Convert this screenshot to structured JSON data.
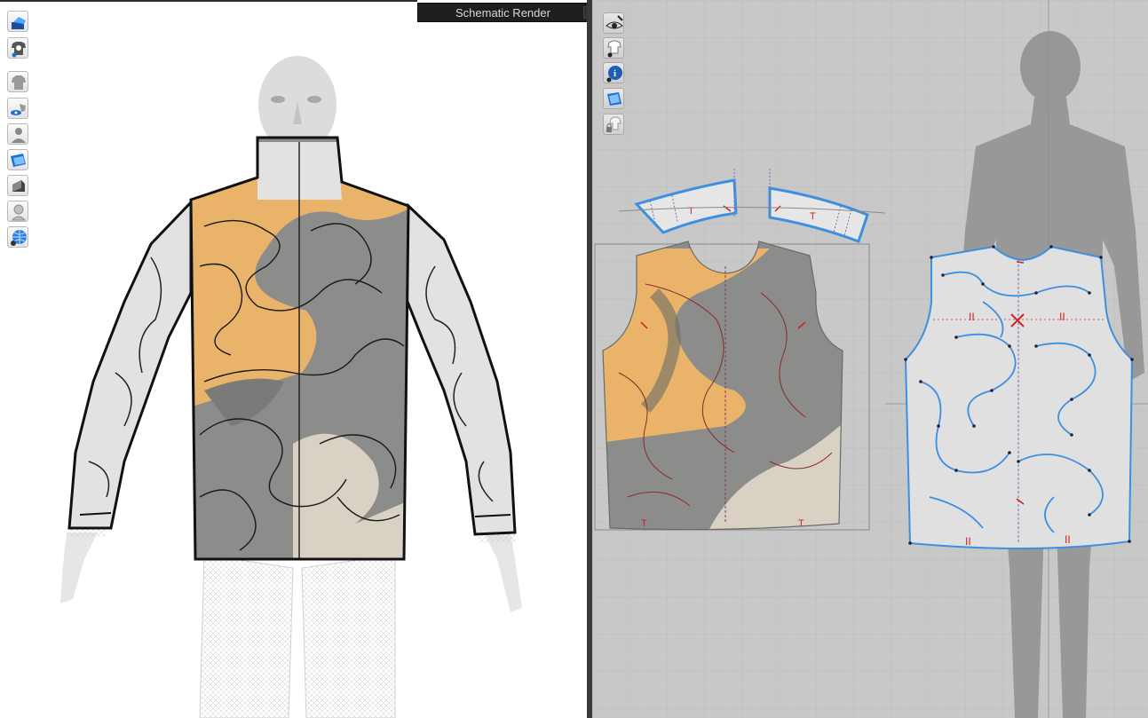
{
  "schematic_window": {
    "title": "Schematic Render",
    "pin_icon": "pin-icon",
    "close_glyph": "✕"
  },
  "toolbar_3d": [
    {
      "name": "simulation-icon"
    },
    {
      "name": "avatar-garment-icon"
    },
    {
      "name": "show-garment-icon"
    },
    {
      "name": "show-pins-icon"
    },
    {
      "name": "show-avatar-icon"
    },
    {
      "name": "texture-surface-icon"
    },
    {
      "name": "thickness-icon"
    },
    {
      "name": "avatar-visibility-icon"
    },
    {
      "name": "environment-icon"
    }
  ],
  "toolbar_2d": [
    {
      "name": "visibility-icon"
    },
    {
      "name": "show-garment-2d-icon"
    },
    {
      "name": "info-icon"
    },
    {
      "name": "texture-2d-icon"
    },
    {
      "name": "lock-garment-icon"
    }
  ],
  "colors": {
    "viewport_3d_bg": "#ffffff",
    "viewport_2d_bg": "#c8c8c8",
    "grid_line": "#bdbdbd",
    "selection_blue": "#3d8fe0",
    "notch_red": "#d21f1f",
    "sand_orange": "#e9b36a",
    "camo_gray": "#8c8c8a",
    "sand_light": "#d9d2c4"
  }
}
